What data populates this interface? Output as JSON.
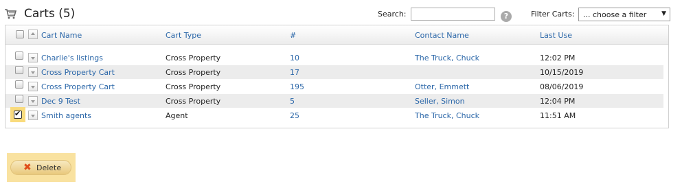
{
  "header": {
    "title": "Carts (5)",
    "icon": "cart-icon"
  },
  "search": {
    "label": "Search:",
    "value": "",
    "placeholder": ""
  },
  "help": {
    "glyph": "?"
  },
  "filter": {
    "label": "Filter Carts:",
    "selected": "... choose a filter"
  },
  "table": {
    "columns": [
      "Cart Name",
      "Cart Type",
      "#",
      "Contact Name",
      "Last Use"
    ],
    "rows": [
      {
        "name": "Charlie's listings",
        "type": "Cross Property",
        "count": "10",
        "contact": "The Truck, Chuck",
        "last_use": "12:02 PM",
        "checked": false
      },
      {
        "name": "Cross Property Cart",
        "type": "Cross Property",
        "count": "17",
        "contact": "",
        "last_use": "10/15/2019",
        "checked": false
      },
      {
        "name": "Cross Property Cart",
        "type": "Cross Property",
        "count": "195",
        "contact": "Otter, Emmett",
        "last_use": "08/06/2019",
        "checked": false
      },
      {
        "name": "Dec 9 Test",
        "type": "Cross Property",
        "count": "5",
        "contact": "Seller, Simon",
        "last_use": "12:04 PM",
        "checked": false
      },
      {
        "name": "Smith agents",
        "type": "Agent",
        "count": "25",
        "contact": "The Truck, Chuck",
        "last_use": "11:51 AM",
        "checked": true
      }
    ]
  },
  "actions": {
    "delete_label": "Delete",
    "delete_glyph": "✖"
  },
  "colors": {
    "link": "#2a66a8",
    "highlight": "#f9db7d",
    "delete_icon": "#e04e1a"
  }
}
